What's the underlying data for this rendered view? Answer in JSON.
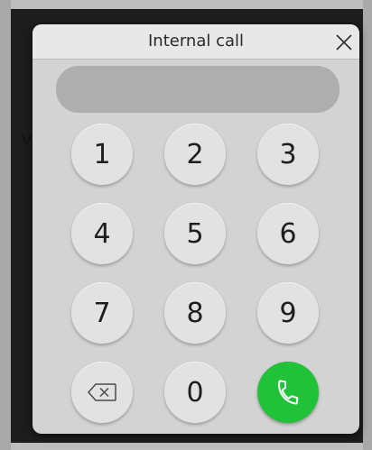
{
  "dialog": {
    "title": "Internal call",
    "close_icon": "close-icon",
    "number_value": ""
  },
  "keypad": {
    "keys": [
      "1",
      "2",
      "3",
      "4",
      "5",
      "6",
      "7",
      "8",
      "9",
      "0"
    ],
    "backspace_icon": "backspace-icon",
    "call_icon": "phone-icon",
    "call_color": "#21c13a"
  },
  "background": {
    "partial_text": "V"
  }
}
